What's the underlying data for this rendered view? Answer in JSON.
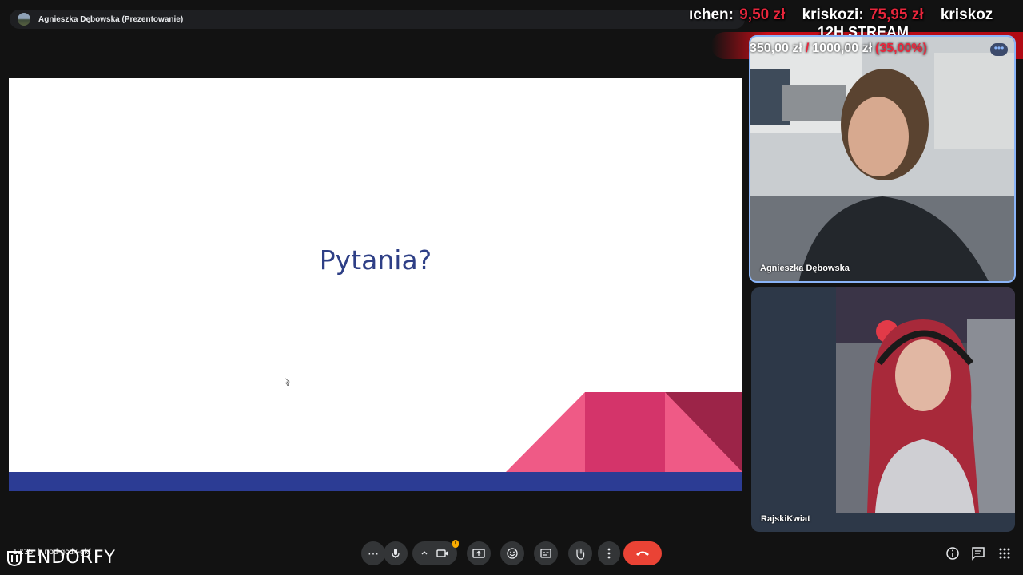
{
  "presenter": {
    "name": "Agnieszka Dębowska (Prezentowanie)"
  },
  "overlay": {
    "ticker": [
      {
        "user": "ıchen:",
        "amount": "9,50 zł"
      },
      {
        "user": "kriskozi:",
        "amount": "75,95 zł"
      },
      {
        "user": "kriskoz",
        "amount": ""
      }
    ],
    "stream_title": "12H STREAM",
    "progress_current": "350,00 zł",
    "progress_separator": "/",
    "progress_goal": "1000,00 zł",
    "progress_percent": "(35,00%)"
  },
  "slide": {
    "title": "Pytania?"
  },
  "tiles": [
    {
      "name": "Agnieszka Dębowska"
    },
    {
      "name": "RajskiKwiat"
    }
  ],
  "meeting": {
    "time": "12:35",
    "separator": "|",
    "code": "nod-gcdx-gkf"
  },
  "watermark": {
    "text": "ENDORFY"
  },
  "controls": {
    "more_options": "⋯",
    "mic_icon": "mic-icon",
    "camera_icon": "camera-icon",
    "present_icon": "present-screen-icon",
    "emoji_icon": "emoji-icon",
    "captions_icon": "captions-icon",
    "hand_icon": "raise-hand-icon",
    "overflow_icon": "more-vert-icon",
    "end_icon": "call-end-icon",
    "warning_badge": "!"
  },
  "colors": {
    "accent_blue": "#8ab4f8",
    "end_call_red": "#ea4335",
    "slide_navy": "#2c3c94",
    "slide_title": "#2e3f86",
    "slide_pink": "#ef5a86",
    "slide_magenta": "#d4346a",
    "slide_wine": "#9c2448",
    "donation_red": "#e8263c"
  }
}
